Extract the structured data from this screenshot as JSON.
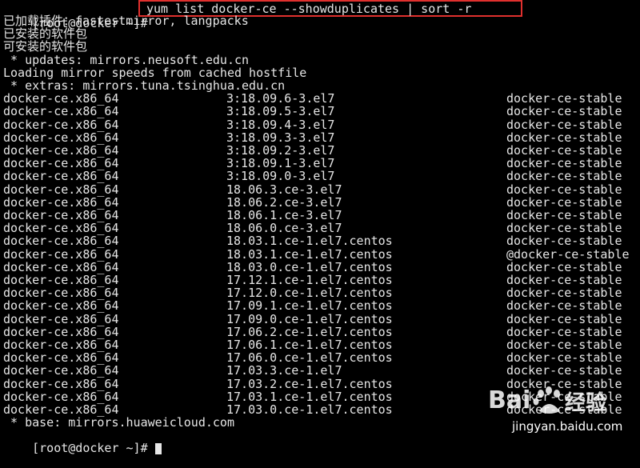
{
  "colors": {
    "background": "#000000",
    "text": "#e6e6e6",
    "highlight_box": "#e0302e"
  },
  "prompt": {
    "first": "[root@docker ~]#",
    "command": "yum list docker-ce --showduplicates | sort -r",
    "last": "[root@docker ~]#"
  },
  "top_partial": "[root@docker ~]#",
  "header_lines": [
    "已加载插件：fastestmirror, langpacks",
    "已安装的软件包",
    "可安装的软件包",
    " * updates: mirrors.neusoft.edu.cn",
    "Loading mirror speeds from cached hostfile",
    " * extras: mirrors.tuna.tsinghua.edu.cn"
  ],
  "packages": [
    {
      "name": "docker-ce.x86_64",
      "version": "3:18.09.6-3.el7",
      "repo": "docker-ce-stable"
    },
    {
      "name": "docker-ce.x86_64",
      "version": "3:18.09.5-3.el7",
      "repo": "docker-ce-stable"
    },
    {
      "name": "docker-ce.x86_64",
      "version": "3:18.09.4-3.el7",
      "repo": "docker-ce-stable"
    },
    {
      "name": "docker-ce.x86_64",
      "version": "3:18.09.3-3.el7",
      "repo": "docker-ce-stable"
    },
    {
      "name": "docker-ce.x86_64",
      "version": "3:18.09.2-3.el7",
      "repo": "docker-ce-stable"
    },
    {
      "name": "docker-ce.x86_64",
      "version": "3:18.09.1-3.el7",
      "repo": "docker-ce-stable"
    },
    {
      "name": "docker-ce.x86_64",
      "version": "3:18.09.0-3.el7",
      "repo": "docker-ce-stable"
    },
    {
      "name": "docker-ce.x86_64",
      "version": "18.06.3.ce-3.el7",
      "repo": "docker-ce-stable"
    },
    {
      "name": "docker-ce.x86_64",
      "version": "18.06.2.ce-3.el7",
      "repo": "docker-ce-stable"
    },
    {
      "name": "docker-ce.x86_64",
      "version": "18.06.1.ce-3.el7",
      "repo": "docker-ce-stable"
    },
    {
      "name": "docker-ce.x86_64",
      "version": "18.06.0.ce-3.el7",
      "repo": "docker-ce-stable"
    },
    {
      "name": "docker-ce.x86_64",
      "version": "18.03.1.ce-1.el7.centos",
      "repo": "docker-ce-stable"
    },
    {
      "name": "docker-ce.x86_64",
      "version": "18.03.1.ce-1.el7.centos",
      "repo": "@docker-ce-stable"
    },
    {
      "name": "docker-ce.x86_64",
      "version": "18.03.0.ce-1.el7.centos",
      "repo": "docker-ce-stable"
    },
    {
      "name": "docker-ce.x86_64",
      "version": "17.12.1.ce-1.el7.centos",
      "repo": "docker-ce-stable"
    },
    {
      "name": "docker-ce.x86_64",
      "version": "17.12.0.ce-1.el7.centos",
      "repo": "docker-ce-stable"
    },
    {
      "name": "docker-ce.x86_64",
      "version": "17.09.1.ce-1.el7.centos",
      "repo": "docker-ce-stable"
    },
    {
      "name": "docker-ce.x86_64",
      "version": "17.09.0.ce-1.el7.centos",
      "repo": "docker-ce-stable"
    },
    {
      "name": "docker-ce.x86_64",
      "version": "17.06.2.ce-1.el7.centos",
      "repo": "docker-ce-stable"
    },
    {
      "name": "docker-ce.x86_64",
      "version": "17.06.1.ce-1.el7.centos",
      "repo": "docker-ce-stable"
    },
    {
      "name": "docker-ce.x86_64",
      "version": "17.06.0.ce-1.el7.centos",
      "repo": "docker-ce-stable"
    },
    {
      "name": "docker-ce.x86_64",
      "version": "17.03.3.ce-1.el7",
      "repo": "docker-ce-stable"
    },
    {
      "name": "docker-ce.x86_64",
      "version": "17.03.2.ce-1.el7.centos",
      "repo": "docker-ce-stable"
    },
    {
      "name": "docker-ce.x86_64",
      "version": "17.03.1.ce-1.el7.centos",
      "repo": "docker-ce-stable"
    },
    {
      "name": "docker-ce.x86_64",
      "version": "17.03.0.ce-1.el7.centos",
      "repo": "docker-ce-stable"
    }
  ],
  "footer_line": " * base: mirrors.huaweicloud.com",
  "watermark": {
    "logo_text": "Baidu经验",
    "url": "jingyan.baidu.com"
  }
}
